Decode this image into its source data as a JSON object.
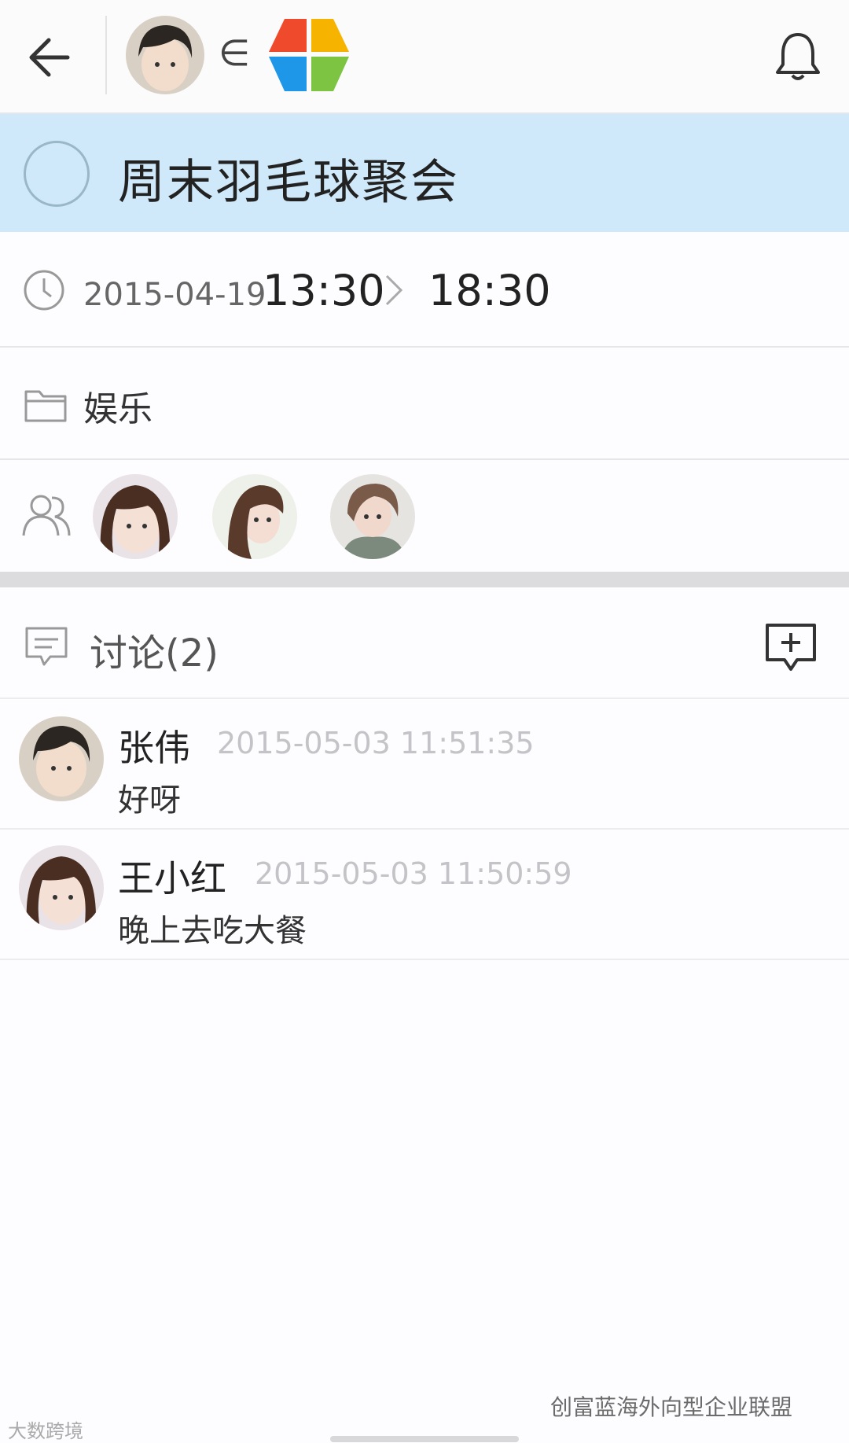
{
  "header": {
    "back_icon": "arrow-left-icon",
    "element_symbol": "∈",
    "bell_icon": "bell-icon",
    "logo_colors": [
      "#f04a2c",
      "#f6b400",
      "#1f97e8",
      "#7cc442"
    ]
  },
  "event": {
    "title": "周末羽毛球聚会",
    "date": "2015-04-19",
    "start_time": "13:30",
    "end_time": "18:30",
    "category": "娱乐"
  },
  "participants": [
    "girl-avatar-1",
    "girl-avatar-2",
    "girl-avatar-3"
  ],
  "discussion": {
    "title": "讨论(2)",
    "comments": [
      {
        "name": "张伟",
        "time": "2015-05-03 11:51:35",
        "text": "好呀"
      },
      {
        "name": "王小红",
        "time": "2015-05-03 11:50:59",
        "text": "晚上去吃大餐"
      }
    ]
  },
  "watermarks": {
    "right": "创富蓝海外向型企业联盟",
    "left": "大数跨境"
  }
}
